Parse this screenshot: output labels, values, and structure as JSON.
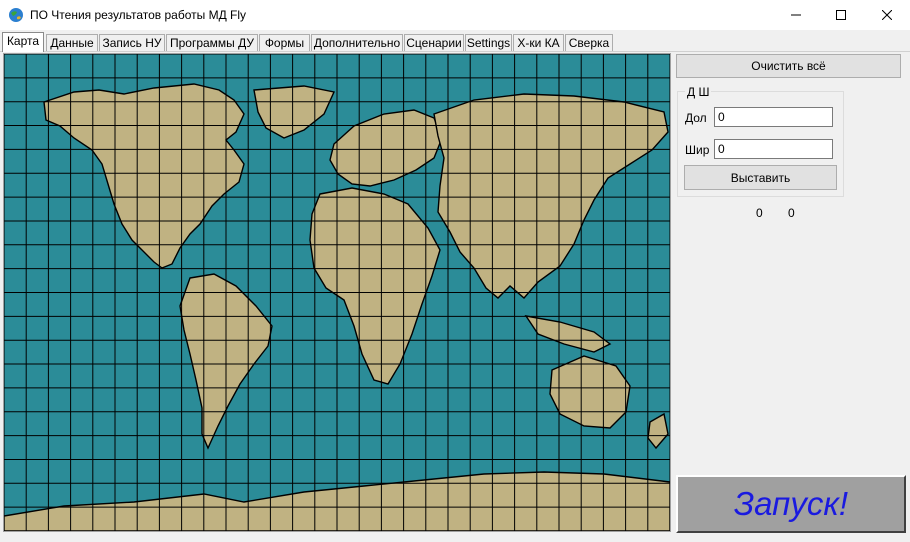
{
  "window": {
    "title": "ПО Чтения результатов работы МД Fly"
  },
  "tabs": [
    {
      "label": "Карта",
      "active": true
    },
    {
      "label": "Данные"
    },
    {
      "label": "Запись НУ"
    },
    {
      "label": "Программы ДУ"
    },
    {
      "label": "Формы"
    },
    {
      "label": "Дополнительно"
    },
    {
      "label": "Сценарии"
    },
    {
      "label": "Settings"
    },
    {
      "label": "Х-ки КА"
    },
    {
      "label": "Сверка"
    }
  ],
  "right_panel": {
    "clear_label": "Очистить всё",
    "group_title": "Д Ш",
    "lon_label": "Дол",
    "lon_value": "0",
    "lat_label": "Шир",
    "lat_value": "0",
    "set_label": "Выставить",
    "coord_a": "0",
    "coord_b": "0",
    "launch_label": "Запуск!"
  },
  "map": {
    "ocean_color": "#2b8c98",
    "land_color": "#c0b282",
    "grid_color": "#000000"
  }
}
